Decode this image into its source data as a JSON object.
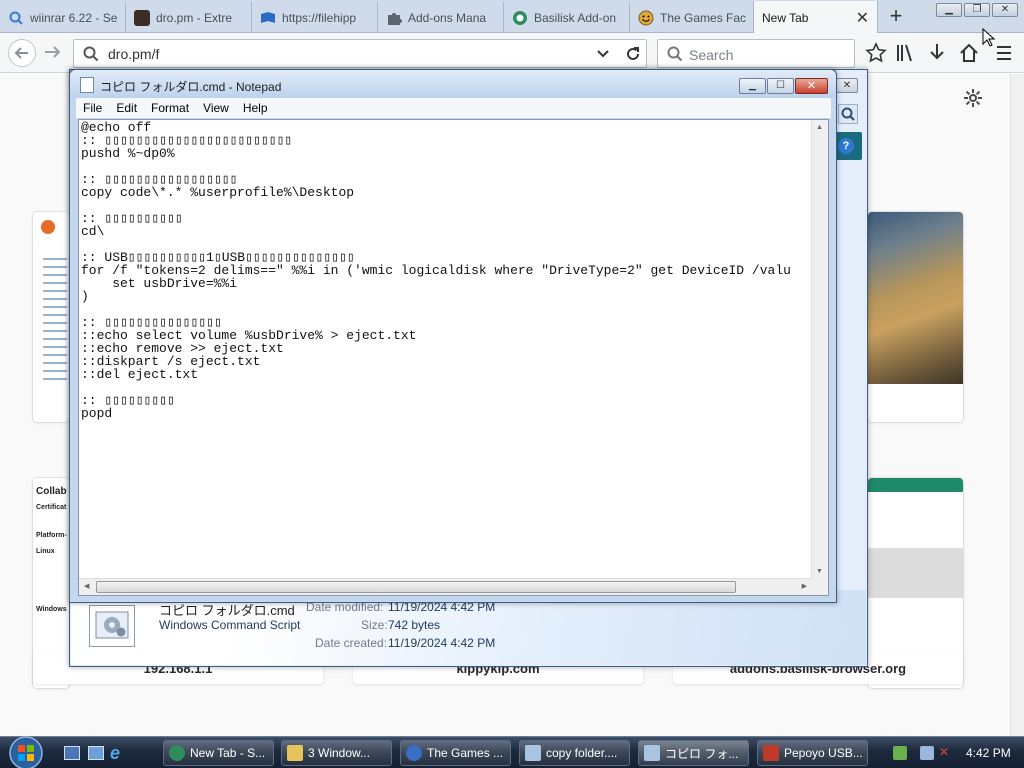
{
  "browser": {
    "tabs": [
      {
        "label": "wiinrar 6.22 - Se",
        "icon": "search-icon",
        "color": "#3b7bd6"
      },
      {
        "label": "dro.pm - Extre",
        "icon": "page-icon",
        "color": "#3a2e26"
      },
      {
        "label": "https://filehipp",
        "icon": "filehippo-icon",
        "color": "#2a6cc4"
      },
      {
        "label": "Add-ons Mana",
        "icon": "puzzle-icon",
        "color": "#5b6470"
      },
      {
        "label": "Basilisk Add-on",
        "icon": "basilisk-icon",
        "color": "#2f8c5c"
      },
      {
        "label": "The Games Fac",
        "icon": "smiley-icon",
        "color": "#e0a93a"
      },
      {
        "label": "New Tab",
        "icon": "",
        "color": ""
      }
    ],
    "new_tab_label": "+",
    "url": "dro.pm/f",
    "search_placeholder": "Search"
  },
  "page_tiles": {
    "captions": [
      "192.168.1.1",
      "kippykip.com",
      "addons.basilisk-browser.org"
    ],
    "left_snippet_title": "Collab",
    "left_snippet_lines": [
      "Certificat",
      "Platform-",
      "Linux",
      "Windows"
    ]
  },
  "notepad": {
    "title": "コピロ フォルダロ.cmd - Notepad",
    "menu": [
      "File",
      "Edit",
      "Format",
      "View",
      "Help"
    ],
    "content": "@echo off\n:: ▯▯▯▯▯▯▯▯▯▯▯▯▯▯▯▯▯▯▯▯▯▯▯▯\npushd %~dp0%\n\n:: ▯▯▯▯▯▯▯▯▯▯▯▯▯▯▯▯▯\ncopy code\\*.* %userprofile%\\Desktop\n\n:: ▯▯▯▯▯▯▯▯▯▯\ncd\\\n\n:: USB▯▯▯▯▯▯▯▯▯▯1▯USB▯▯▯▯▯▯▯▯▯▯▯▯▯▯\nfor /f \"tokens=2 delims==\" %%i in ('wmic logicaldisk where \"DriveType=2\" get DeviceID /valu\n    set usbDrive=%%i\n)\n\n:: ▯▯▯▯▯▯▯▯▯▯▯▯▯▯▯\n::echo select volume %usbDrive% > eject.txt\n::echo remove >> eject.txt\n::diskpart /s eject.txt\n::del eject.txt\n\n:: ▯▯▯▯▯▯▯▯▯\npopd"
  },
  "explorer": {
    "file_name": "コピロ フォルダロ.cmd",
    "file_type": "Windows Command Script",
    "date_modified_label": "Date modified:",
    "date_modified": "11/19/2024 4:42 PM",
    "size_label": "Size:",
    "size": "742 bytes",
    "date_created_label": "Date created:",
    "date_created": "11/19/2024 4:42 PM"
  },
  "taskbar": {
    "buttons": [
      {
        "label": "New Tab - S...",
        "icon": "basilisk-icon",
        "color": "#2f8c5c"
      },
      {
        "label": "3 Window...",
        "icon": "folder-icon",
        "color": "#e8c25a"
      },
      {
        "label": "The Games ...",
        "icon": "tgf-icon",
        "color": "#3b6fc4"
      },
      {
        "label": "copy folder....",
        "icon": "notepad-icon",
        "color": "#a9c4e0"
      },
      {
        "label": "コピロ フォ...",
        "icon": "notepad-icon",
        "color": "#a9c4e0"
      },
      {
        "label": "Pepoyo USB...",
        "icon": "app-icon",
        "color": "#c0392b"
      }
    ],
    "clock": "4:42 PM"
  },
  "colors": {
    "tabbar": "#cfdaea",
    "taskbar": "#1d2a3d",
    "notepad_frame": "#c4d7ef"
  }
}
